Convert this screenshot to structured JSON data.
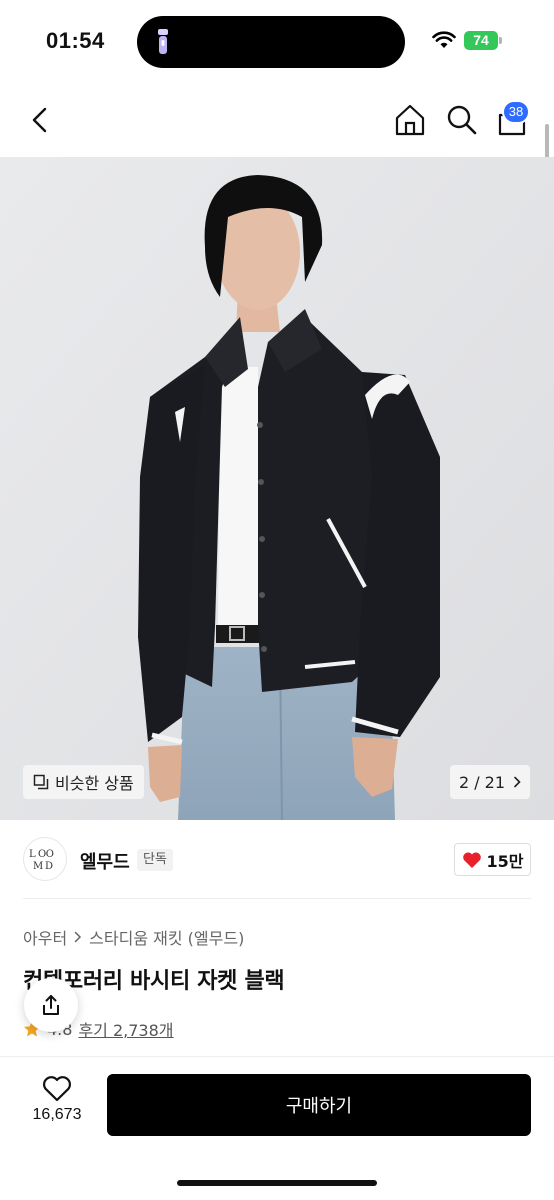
{
  "status_bar": {
    "time": "01:54",
    "battery": "74"
  },
  "header": {
    "cart_count": "38"
  },
  "gallery": {
    "similar_label": "비슷한 상품",
    "page_indicator": "2 / 21"
  },
  "brand": {
    "logo_text": "LMOOD",
    "name": "엘무드",
    "tag": "단독",
    "like_count": "15만"
  },
  "product": {
    "category_parent": "아우터",
    "category_child": "스타디움 재킷 (엘무드)",
    "title": "컨템포러리 바시티 자켓 블랙",
    "rating": "4.8",
    "reviews": "후기 2,738개"
  },
  "bottom_bar": {
    "wish_count": "16,673",
    "buy_label": "구매하기"
  },
  "colors": {
    "badge": "#2f6bff",
    "battery": "#34c759",
    "heart": "#e8202a",
    "star": "#f5a623",
    "buy_button": "#000000"
  },
  "icons": [
    "flashlight-icon",
    "wifi-icon",
    "back-arrow-icon",
    "home-icon",
    "search-icon",
    "shopping-bag-icon",
    "similar-products-icon",
    "chevron-right-icon",
    "heart-icon",
    "share-icon",
    "star-icon",
    "heart-outline-icon"
  ]
}
